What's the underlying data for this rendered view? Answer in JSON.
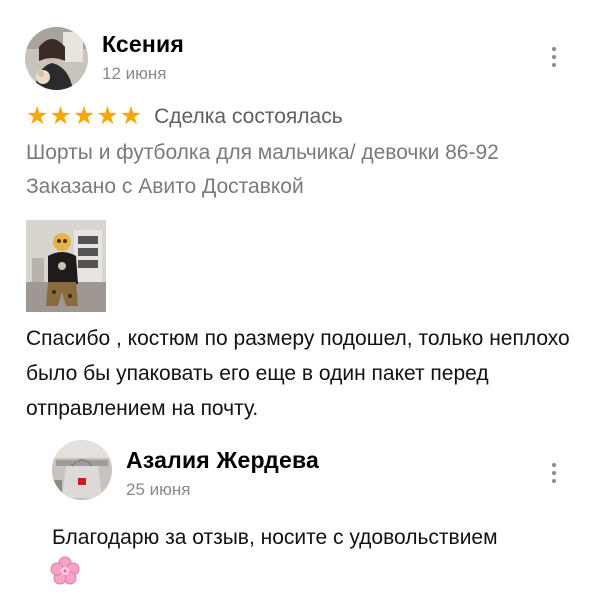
{
  "review": {
    "author": "Ксения",
    "date": "12 июня",
    "rating": 5,
    "deal_status": "Сделка состоялась",
    "item_title": "Шорты и футболка для мальчика/ девочки 86-92",
    "delivery_note": "Заказано с Авито Доставкой",
    "text": "Спасибо , костюм по размеру подошел, только неплохо было бы упаковать его еще в один пакет перед отправлением на почту."
  },
  "reply": {
    "author": "Азалия Жердева",
    "date": "25 июня",
    "text": "Благодарю за отзыв, носите с удовольствием"
  },
  "icons": {
    "star": "star-icon",
    "menu": "more-vertical-icon",
    "flower": "cherry-blossom-emoji"
  },
  "colors": {
    "star": "#f7a800",
    "secondary_text": "#7a7a7a"
  }
}
